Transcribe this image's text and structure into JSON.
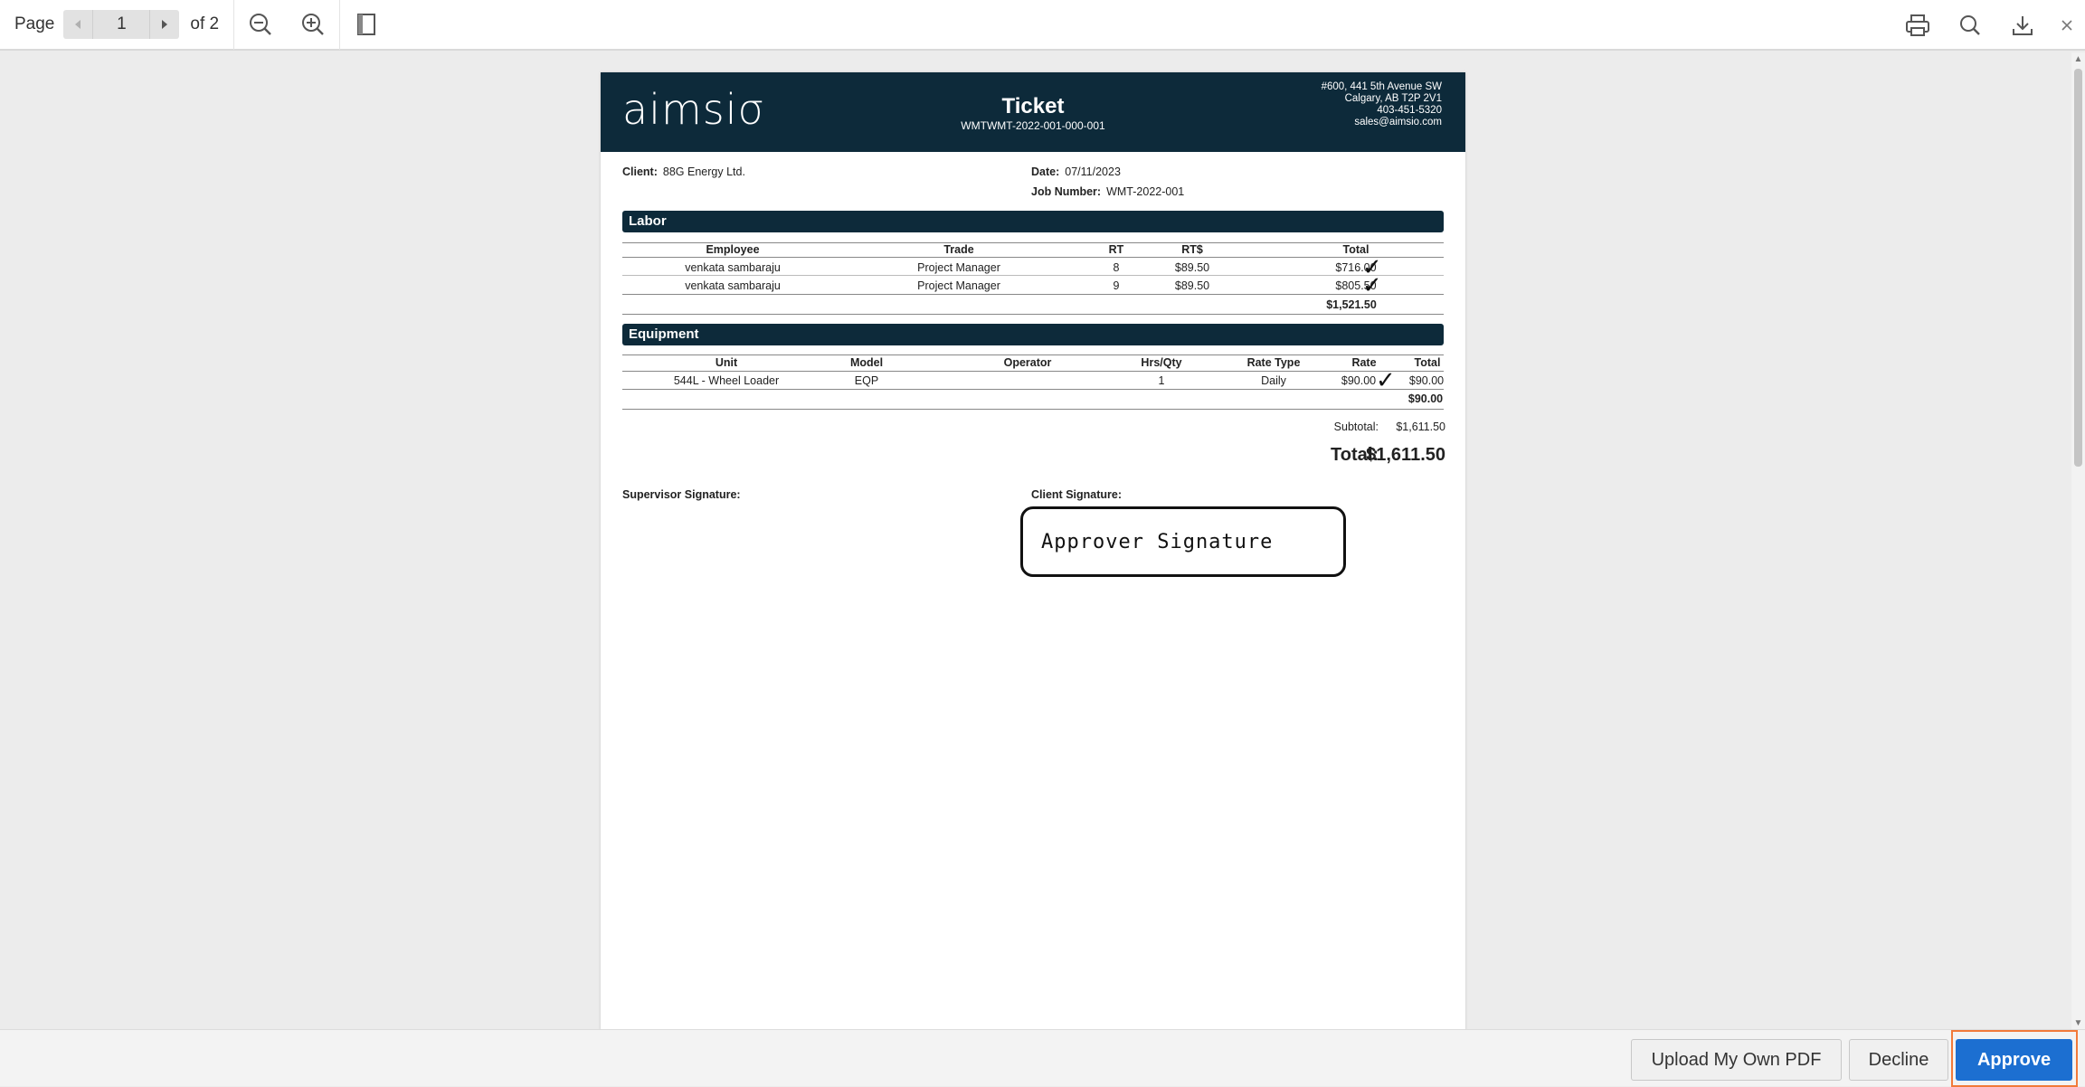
{
  "toolbar": {
    "page_label": "Page",
    "current_page": "1",
    "of_label": "of 2",
    "icons": [
      "prev-page-icon",
      "next-page-icon",
      "zoom-out-icon",
      "zoom-in-icon",
      "single-page-view-icon",
      "print-icon",
      "search-icon",
      "download-icon",
      "close-icon"
    ]
  },
  "document": {
    "logo_text": "aimsiσ",
    "title": "Ticket",
    "ticket_number": "WMTWMT-2022-001-000-001",
    "address": [
      "#600, 441 5th Avenue SW",
      "Calgary, AB T2P 2V1",
      "403-451-5320",
      "sales@aimsio.com"
    ],
    "client_label": "Client:",
    "client_value": "88G Energy Ltd.",
    "date_label": "Date:",
    "date_value": "07/11/2023",
    "job_label": "Job Number:",
    "job_value": "WMT-2022-001",
    "labor": {
      "title": "Labor",
      "headers": [
        "Employee",
        "Trade",
        "RT",
        "RT$",
        "Total"
      ],
      "rows": [
        [
          "venkata sambaraju",
          "Project Manager",
          "8",
          "$89.50",
          "$716.00"
        ],
        [
          "venkata sambaraju",
          "Project Manager",
          "9",
          "$89.50",
          "$805.50"
        ]
      ],
      "subtotal": "$1,521.50"
    },
    "equipment": {
      "title": "Equipment",
      "headers": [
        "Unit",
        "Model",
        "Operator",
        "Hrs/Qty",
        "Rate Type",
        "Rate",
        "Total"
      ],
      "rows": [
        [
          "544L - Wheel Loader",
          "EQP",
          "",
          "1",
          "Daily",
          "$90.00",
          "$90.00"
        ]
      ],
      "subtotal": "$90.00"
    },
    "subtotal_label": "Subtotal:",
    "subtotal_value": "$1,611.50",
    "total_label": "Total:",
    "total_value": "$1,611.50",
    "supervisor_signature_label": "Supervisor Signature:",
    "client_signature_label": "Client Signature:",
    "approver_signature_text": "Approver Signature",
    "check_mark": "✓"
  },
  "actions": {
    "upload_label": "Upload My Own PDF",
    "decline_label": "Decline",
    "approve_label": "Approve"
  },
  "colors": {
    "header_bg": "#0d2a3a",
    "approve_bg": "#1c6fd1",
    "approve_focus": "#f27a3a"
  }
}
